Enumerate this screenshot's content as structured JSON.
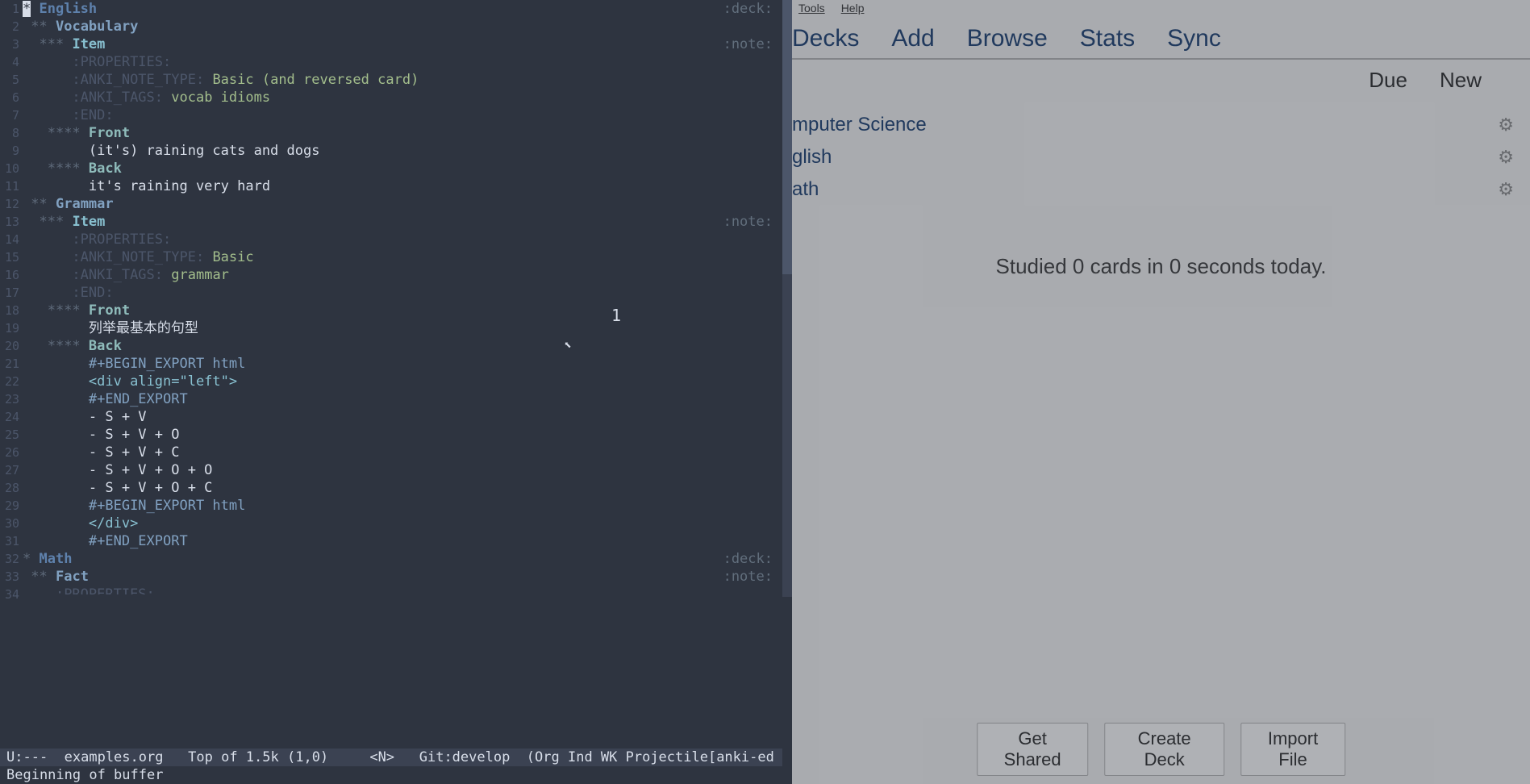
{
  "editor": {
    "line_numbers": [
      "1",
      "2",
      "3",
      "4",
      "5",
      "6",
      "7",
      "8",
      "9",
      "10",
      "11",
      "12",
      "13",
      "14",
      "15",
      "16",
      "17",
      "18",
      "19",
      "20",
      "21",
      "22",
      "23",
      "24",
      "25",
      "26",
      "27",
      "28",
      "29",
      "30",
      "31",
      "32",
      "33",
      "34"
    ],
    "h1_english": "English",
    "tag_deck": ":deck:",
    "h2_vocab": "Vocabulary",
    "h3_item": "Item",
    "tag_note": ":note:",
    "prop_begin": ":PROPERTIES:",
    "prop_note_type_key": ":ANKI_NOTE_TYPE:",
    "prop_note_type_val1": "Basic (and reversed card)",
    "prop_tags_key": ":ANKI_TAGS:",
    "prop_tags_val1": "vocab idioms",
    "prop_end": ":END:",
    "h4_front": "Front",
    "front1": "(it's) raining cats and dogs",
    "h4_back": "Back",
    "back1": "it's raining very hard",
    "h2_grammar": "Grammar",
    "prop_note_type_val2": "Basic",
    "prop_tags_val2": "grammar",
    "front2": "列举最基本的句型",
    "begin_export": "#+BEGIN_EXPORT html",
    "div_open": "<div align=\"left\">",
    "end_export": "#+END_EXPORT",
    "list1": "- S + V",
    "list2": "- S + V + O",
    "list3": "- S + V + C",
    "list4": "- S + V + O + O",
    "list5": "- S + V + O + C",
    "div_close": "</div>",
    "h1_math": "Math",
    "h2_fact": "Fact",
    "prop_begin_partial": ":PROPERTIES:",
    "floating": "1",
    "modeline": "U:---  examples.org   Top of 1.5k (1,0)     <N>   Git:develop  (Org Ind WK Projectile[anki-ed",
    "minibuffer": "Beginning of buffer"
  },
  "anki": {
    "menu_tools": "Tools",
    "menu_help": "Help",
    "tab_decks": "Decks",
    "tab_add": "Add",
    "tab_browse": "Browse",
    "tab_stats": "Stats",
    "tab_sync": "Sync",
    "col_due": "Due",
    "col_new": "New",
    "decks": [
      {
        "name": "mputer Science"
      },
      {
        "name": "glish"
      },
      {
        "name": "ath"
      }
    ],
    "status": "Studied 0 cards in 0 seconds today.",
    "btn_get_shared": "Get Shared",
    "btn_create_deck": "Create Deck",
    "btn_import_file": "Import File"
  }
}
